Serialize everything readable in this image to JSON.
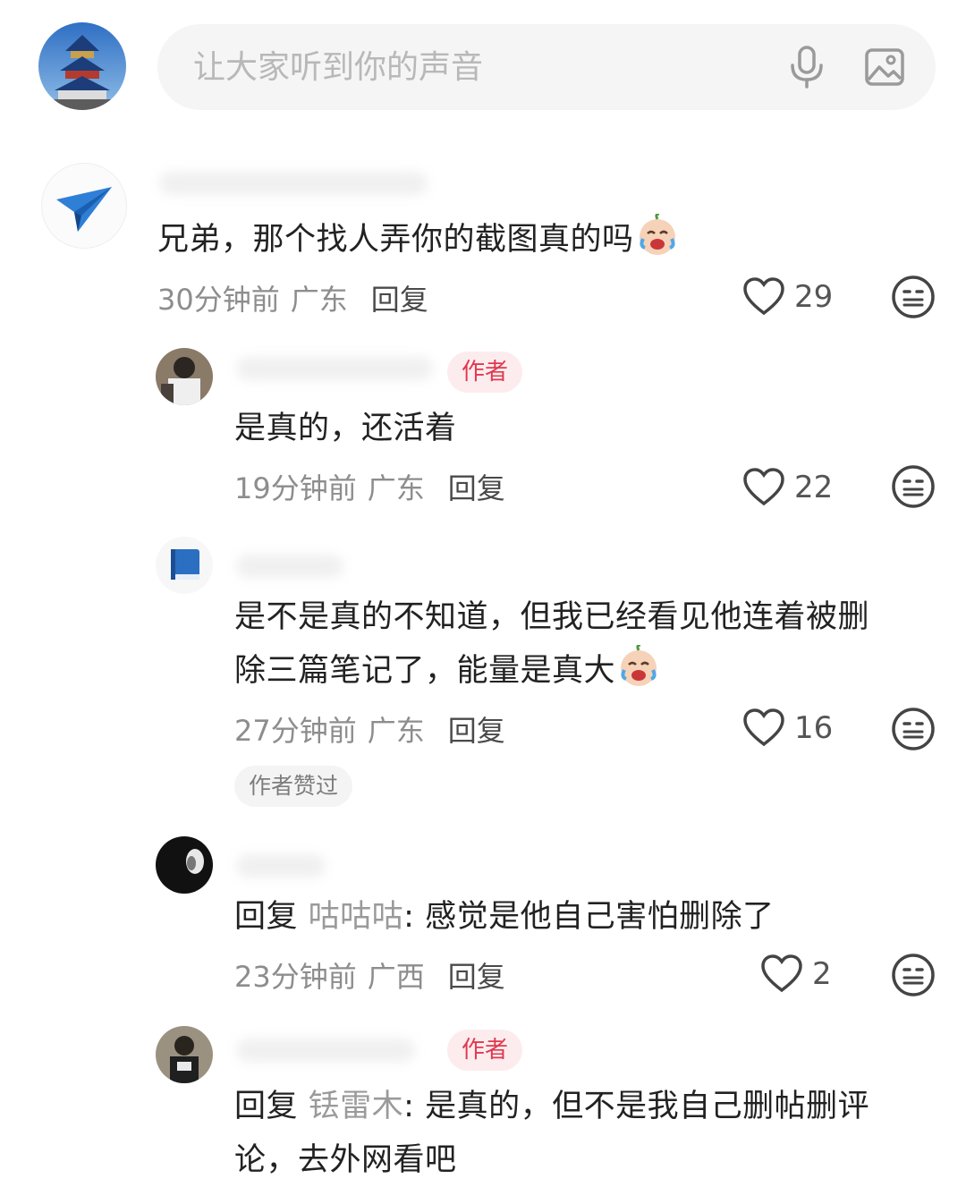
{
  "input": {
    "placeholder": "让大家听到你的声音"
  },
  "comments": [
    {
      "text": "兄弟，那个找人弄你的截图真的吗",
      "time": "30分钟前",
      "location": "广东",
      "reply_label": "回复",
      "likes": "29",
      "emoji": "crying-laughing-emoji"
    },
    {
      "badge": "作者",
      "text": "是真的，还活着",
      "time": "19分钟前",
      "location": "广东",
      "reply_label": "回复",
      "likes": "22"
    },
    {
      "text_line1": "是不是真的不知道，但我已经看见他连着被删",
      "text_line2": "除三篇笔记了，能量是真大",
      "time": "27分钟前",
      "location": "广东",
      "reply_label": "回复",
      "likes": "16",
      "liked_badge": "作者赞过",
      "emoji": "crying-laughing-emoji"
    },
    {
      "reply_prefix": "回复",
      "mention": "咕咕咕",
      "text": ": 感觉是他自己害怕删除了",
      "time": "23分钟前",
      "location": "广西",
      "reply_label": "回复",
      "likes": "2"
    },
    {
      "badge": "作者",
      "reply_prefix": "回复",
      "mention": "铥雷木",
      "text_line1": ": 是真的，但不是我自己删帖删评",
      "text_line2": "论，去外网看吧"
    }
  ],
  "colors": {
    "author_badge": "#e0394e",
    "author_badge_bg": "#fdecee",
    "muted": "#8d8d8d"
  },
  "icons": [
    "mic-icon",
    "image-icon",
    "heart-icon",
    "dislike-face-icon"
  ]
}
